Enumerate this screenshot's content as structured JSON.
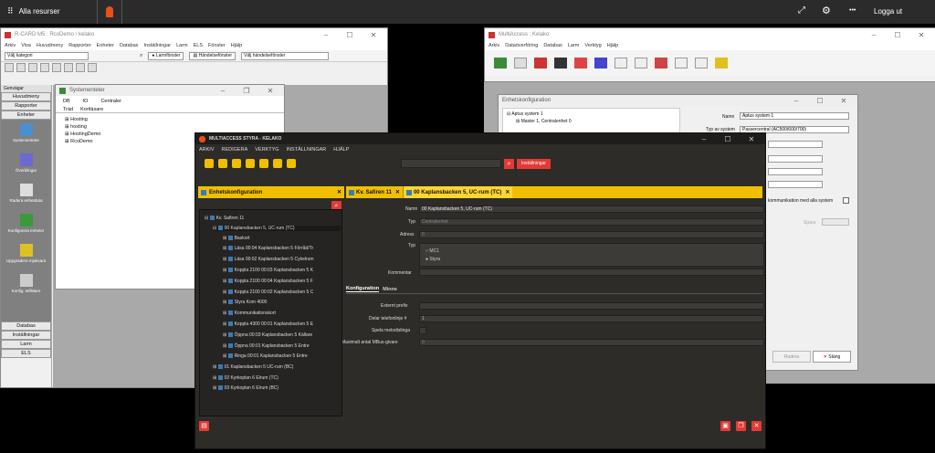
{
  "taskbar": {
    "menu_label": "Alla resurser",
    "logout": "Logga ut",
    "more": "•••"
  },
  "rcard": {
    "title": "R-CARD M5 : RcoDemo / kelako",
    "menus": [
      "Arkiv",
      "Visa",
      "Huvudmeny",
      "Rapporter",
      "Enheter",
      "Databas",
      "Inställningar",
      "Larm",
      "ELS",
      "Fönster",
      "Hjälp"
    ],
    "category_select": "Välj kategori",
    "larm_btn": "Larmfönster",
    "handelse_btn": "Händelsefönster",
    "handelse_select": "Välj händelsefönster",
    "side_header": "Genvägar",
    "side_top": [
      "Huvudmeny",
      "Rapporter",
      "Enheter"
    ],
    "side_icons": [
      "Systementeter",
      "Överblingar",
      "Radera enhetdata",
      "Konfigurera enheter",
      "Uppgradera mjukvara",
      "Konfig. MifWare"
    ],
    "side_bottom": [
      "Databas",
      "Inställningar",
      "Larm",
      "ELS"
    ]
  },
  "systementer": {
    "title": "Systementeter",
    "tabs": [
      "DB",
      "IO",
      "Centraler"
    ],
    "tabs2": [
      "Träd",
      "Kortläsare"
    ],
    "items": [
      "Hosting",
      "hosting",
      "HostingDemo",
      "RcoDemo"
    ]
  },
  "ma": {
    "title": "MultiAccess : Kelako",
    "menus": [
      "Arkiv",
      "Dataöverföring",
      "Databas",
      "Larm",
      "Verktyg",
      "Hjälp"
    ]
  },
  "enhetkonf_bg": {
    "title": "Enhetskonfiguration",
    "tree_root": "Aptus system 1",
    "tree_child": "Master 1, Centralenhet 0",
    "name_label": "Namn",
    "name_value": "Aptus system 1",
    "typ_label": "Typ av system",
    "typ_value": "Passercentral (AC500/600/700)",
    "comm_label": "kommunikation med alla system",
    "spara": "Spara",
    "radera": "Radera",
    "stang": "Stäng"
  },
  "styra": {
    "title": "MULTIACCESS STYRA - KELAKO",
    "menus": [
      "ARKIV",
      "REDIGERA",
      "VERKTYG",
      "INSTÄLLNINGAR",
      "HJÄLP"
    ],
    "settings_btn": "Inställningar",
    "panel_title": "Enhetskonfiguration",
    "tab1": "Kv. Safiren 11",
    "tab2": "00 Kaplansbacken 5, UC-rum (TC)",
    "tree": [
      "Kv. Safiren 11",
      "00 Kaplansbacken 5, UC-rum (TC)",
      "Baskort",
      "Läsa 00:04 Kaplansbacken 5 Förråd/Tr",
      "Läsa 00:02 Kaplansbacken 5 Cykelrum",
      "Koppla 2100 00:03 Kaplansbacken 5 K",
      "Koppla 2100 00:04 Kaplansbacken 5 F",
      "Koppla 2100 00:02 Kaplansbacken 5 C",
      "Styra Kom 4000",
      "Kommunikationskort",
      "Koppla 4300 00:01 Kaplansbacken 5 E",
      "Öppna 00:03 Kaplansbacken 5 Källare",
      "Öppna 00:01 Kaplansbacken 5 Entre",
      "Ringa 00:01 Kaplansbacken 5 Entre",
      "01 Kaplansbacken 5 UC-rum (BC)",
      "02 Kyrkoplan 6 Elrum (TC)",
      "03 Kyrkoplan 6 Elrum (BC)"
    ],
    "namn_label": "Namn",
    "namn_value": "00 Kaplansbacken 5, UC-rum (TC)",
    "typ_label": "Typ",
    "typ_value": "Centralenhet",
    "adress_label": "Adress",
    "adress_value": "0",
    "typ2_label": "Typ",
    "opt1": "MC1",
    "opt2": "Styra",
    "kommentar_label": "Kommentar",
    "sub_tab1": "Konfiguration",
    "sub_tab2": "Minne",
    "ext_label": "Externt prefix",
    "delar_label": "Delar telefonlinje #",
    "delar_value": "1",
    "spela_label": "Spela melodislinga",
    "max_label": "Maximalt antal MBus-givare",
    "max_value": "0"
  }
}
